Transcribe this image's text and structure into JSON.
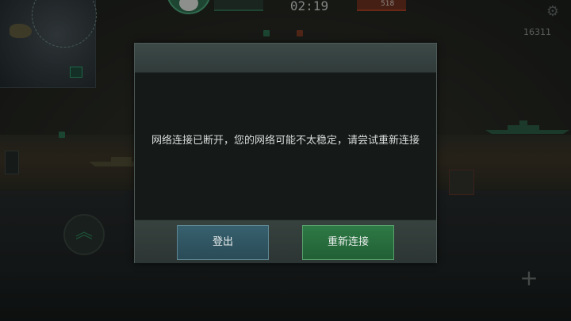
{
  "hud": {
    "timer": "02:19",
    "enemy_score": "518",
    "player_score": "16311"
  },
  "dialog": {
    "message": "网络连接已断开，您的网络可能不太稳定，请尝试重新连接",
    "logout_label": "登出",
    "reconnect_label": "重新连接"
  },
  "icons": {
    "settings": "gear-icon",
    "zoom": "plus-icon",
    "speed_up": "chevron-up-icon"
  },
  "colors": {
    "dialog_bg": "#151a19",
    "dialog_header": "#3c4947",
    "logout_button": "#2a4b57",
    "reconnect_button": "#2e7a45",
    "message_text": "#d9dddb"
  }
}
